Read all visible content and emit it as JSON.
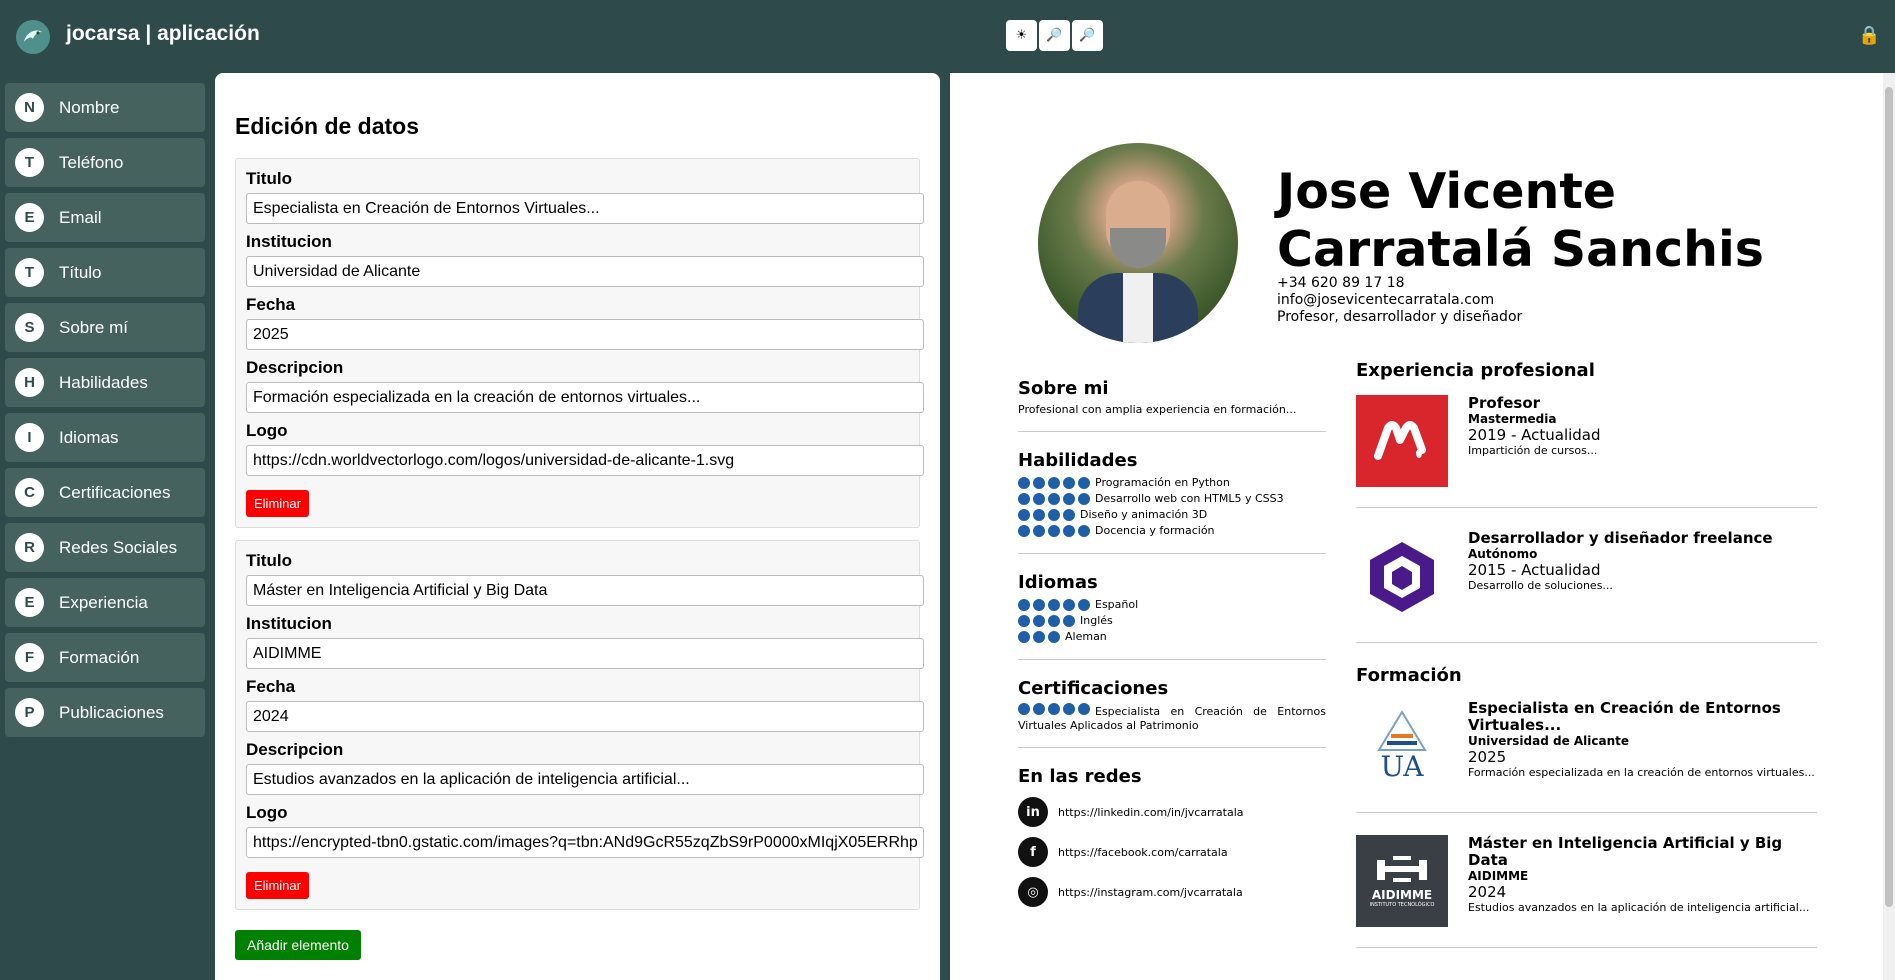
{
  "app": {
    "title": "jocarsa | aplicación"
  },
  "toolbar": {
    "buttons": [
      "☀",
      "🔎",
      "🔎"
    ]
  },
  "colors": {
    "background": "#2e4a4a",
    "sidebar_item": "#45625f",
    "delete": "#ff0000",
    "add": "#008000",
    "skill_dot": "#1f5fa8"
  },
  "sidebar": {
    "items": [
      {
        "badge": "N",
        "label": "Nombre"
      },
      {
        "badge": "T",
        "label": "Teléfono"
      },
      {
        "badge": "E",
        "label": "Email"
      },
      {
        "badge": "T",
        "label": "Título"
      },
      {
        "badge": "S",
        "label": "Sobre mí"
      },
      {
        "badge": "H",
        "label": "Habilidades"
      },
      {
        "badge": "I",
        "label": "Idiomas"
      },
      {
        "badge": "C",
        "label": "Certificaciones"
      },
      {
        "badge": "R",
        "label": "Redes Sociales"
      },
      {
        "badge": "E",
        "label": "Experiencia"
      },
      {
        "badge": "F",
        "label": "Formación"
      },
      {
        "badge": "P",
        "label": "Publicaciones"
      }
    ]
  },
  "editor": {
    "heading": "Edición de datos",
    "labels": {
      "titulo": "Titulo",
      "institucion": "Institucion",
      "fecha": "Fecha",
      "descripcion": "Descripcion",
      "logo": "Logo"
    },
    "entries": [
      {
        "titulo": "Especialista en Creación de Entornos Virtuales...",
        "institucion": "Universidad de Alicante",
        "fecha": "2025",
        "descripcion": "Formación especializada en la creación de entornos virtuales...",
        "logo": "https://cdn.worldvectorlogo.com/logos/universidad-de-alicante-1.svg"
      },
      {
        "titulo": "Máster en Inteligencia Artificial y Big Data",
        "institucion": "AIDIMME",
        "fecha": "2024",
        "descripcion": "Estudios avanzados en la aplicación de inteligencia artificial...",
        "logo": "https://encrypted-tbn0.gstatic.com/images?q=tbn:ANd9GcR55zqZbS9rP0000xMIqjX05ERRhp"
      }
    ],
    "delete_label": "Eliminar",
    "add_label": "Añadir elemento"
  },
  "cv": {
    "name_line1": "Jose Vicente",
    "name_line2": "Carratalá Sanchis",
    "phone": "+34 620 89 17 18",
    "email": "info@josevicentecarratala.com",
    "role": "Profesor, desarrollador y diseñador",
    "about": {
      "title": "Sobre mi",
      "text": "Profesional con amplia experiencia en formación..."
    },
    "skills": {
      "title": "Habilidades",
      "items": [
        {
          "dots": 5,
          "label": "Programación en Python"
        },
        {
          "dots": 5,
          "label": "Desarrollo web con HTML5 y CSS3"
        },
        {
          "dots": 4,
          "label": "Diseño y animación 3D"
        },
        {
          "dots": 5,
          "label": "Docencia y formación"
        }
      ]
    },
    "languages": {
      "title": "Idiomas",
      "items": [
        {
          "dots": 5,
          "label": "Español"
        },
        {
          "dots": 4,
          "label": "Inglés"
        },
        {
          "dots": 3,
          "label": "Aleman"
        }
      ]
    },
    "certifications": {
      "title": "Certificaciones",
      "dots": 5,
      "text": "Especialista en Creación de Entornos Virtuales Aplicados al Patrimonio"
    },
    "social": {
      "title": "En las redes",
      "items": [
        {
          "icon": "linkedin-icon",
          "glyph": "in",
          "url": "https://linkedin.com/in/jvcarratala"
        },
        {
          "icon": "facebook-icon",
          "glyph": "f",
          "url": "https://facebook.com/carratala"
        },
        {
          "icon": "instagram-icon",
          "glyph": "◎",
          "url": "https://instagram.com/jvcarratala"
        }
      ]
    },
    "experience": {
      "title": "Experiencia profesional",
      "items": [
        {
          "title": "Profesor",
          "org": "Mastermedia",
          "date": "2019 - Actualidad",
          "desc": "Impartición de cursos..."
        },
        {
          "title": "Desarrollador y diseñador freelance",
          "org": "Autónomo",
          "date": "2015 - Actualidad",
          "desc": "Desarrollo de soluciones..."
        }
      ]
    },
    "education": {
      "title": "Formación",
      "items": [
        {
          "title": "Especialista en Creación de Entornos Virtuales...",
          "org": "Universidad de Alicante",
          "date": "2025",
          "desc": "Formación especializada en la creación de entornos virtuales...",
          "logo_text": "UA"
        },
        {
          "title": "Máster en Inteligencia Artificial y Big Data",
          "org": "AIDIMME",
          "date": "2024",
          "desc": "Estudios avanzados en la aplicación de inteligencia artificial...",
          "logo_text": "AIDIMME",
          "logo_subtext": "INSTITUTO TECNOLÓGICO"
        }
      ]
    }
  }
}
